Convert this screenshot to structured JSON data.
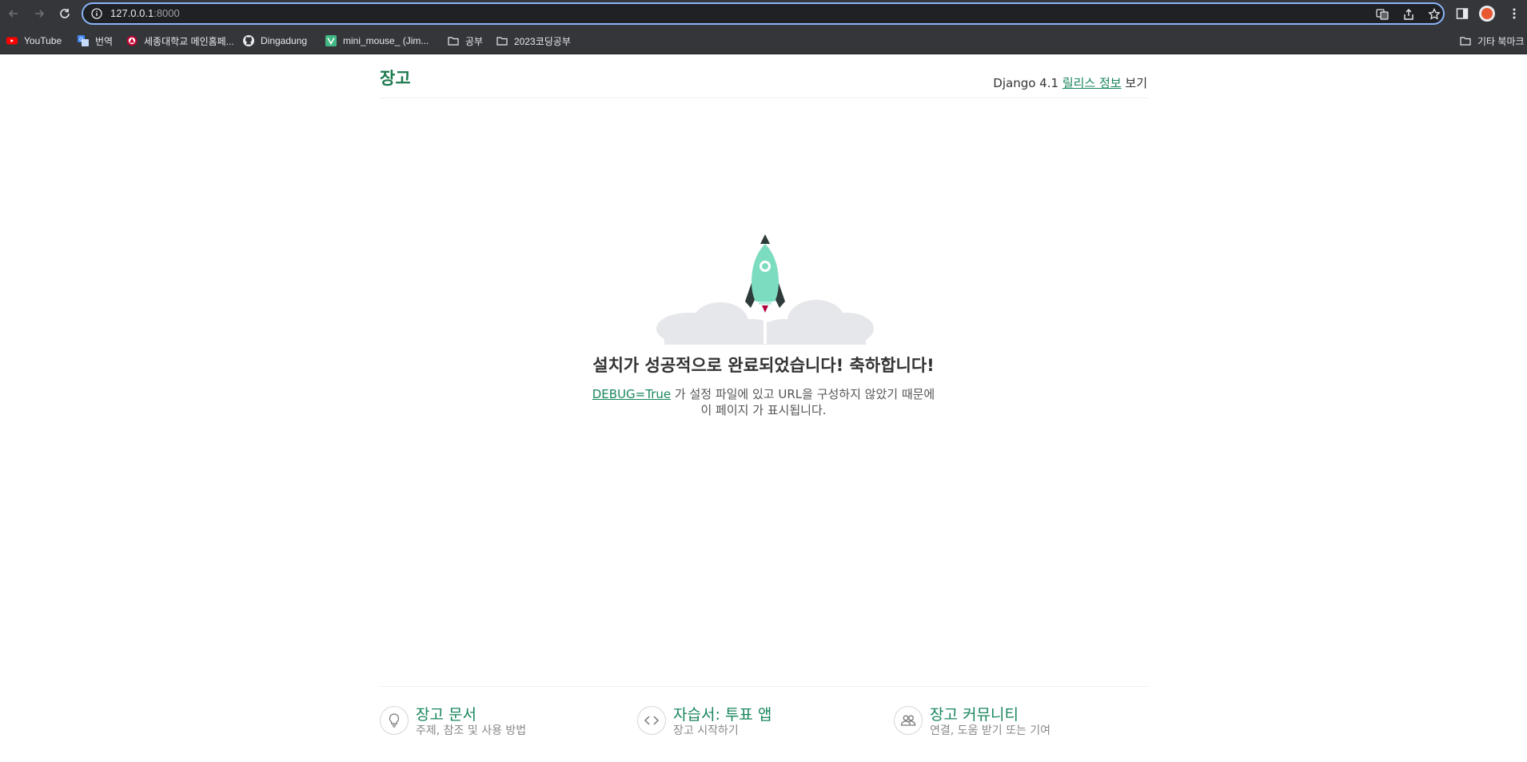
{
  "browser": {
    "url_host": "127.0.0.1",
    "url_port": ":8000",
    "bookmarks": [
      {
        "label": "YouTube",
        "icon": "youtube-icon"
      },
      {
        "label": "번역",
        "icon": "translate-icon"
      },
      {
        "label": "세종대학교 메인홈페...",
        "icon": "university-icon"
      },
      {
        "label": "Dingadung",
        "icon": "github-icon"
      },
      {
        "label": "mini_mouse_ (Jim...",
        "icon": "vue-icon"
      },
      {
        "label": "공부",
        "icon": "folder-icon"
      },
      {
        "label": "2023코딩공부",
        "icon": "folder-icon"
      }
    ],
    "other_bookmarks": "기타 북마크"
  },
  "header": {
    "logo": "장고",
    "release_prefix": "Django 4.1",
    "release_link": "릴리스 정보",
    "release_suffix": "보기"
  },
  "hero": {
    "headline": "설치가 성공적으로 완료되었습니다! 축하합니다!",
    "debug_link": "DEBUG=True",
    "line1_rest": "가 설정 파일에 있고 URL을 구성하지 않았기 때문에",
    "line2": "이 페이지 가 표시됩니다."
  },
  "footer": {
    "items": [
      {
        "title": "장고 문서",
        "desc": "주제, 참조 및 사용 방법",
        "icon": "lightbulb-icon"
      },
      {
        "title": "자습서: 투표 앱",
        "desc": "장고 시작하기",
        "icon": "code-icon"
      },
      {
        "title": "장고 커뮤니티",
        "desc": "연결, 도움 받기 또는 기여",
        "icon": "community-icon"
      }
    ]
  },
  "colors": {
    "django_green": "#19865c",
    "rocket_body": "#7cdcc0",
    "chrome_dark": "#35363a"
  }
}
